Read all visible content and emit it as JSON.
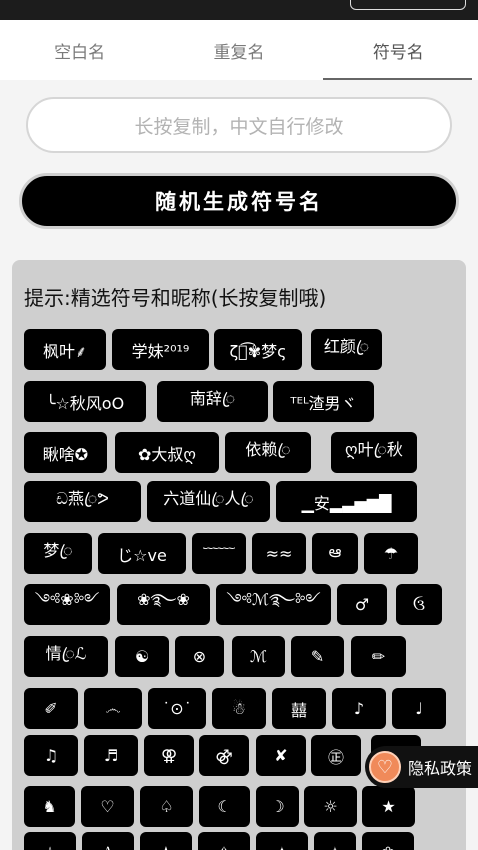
{
  "tabs": [
    "空白名",
    "重复名",
    "符号名"
  ],
  "active_tab_index": 2,
  "copy_field": {
    "placeholder": "长按复制，中文自行修改"
  },
  "generate_button": "随机生成符号名",
  "panel_title": "提示:精选符号和昵称(长按复制哦)",
  "chips": [
    [
      "枫叶⸙",
      "学妹²⁰¹⁹",
      "ζั͡✾梦ς",
      "红颜ꦿ"
    ],
    [
      "╰☆秋风oO",
      "南辞ꦿ",
      "ᵀᴱᴸ渣男ヾ"
    ],
    [
      "瞅啥✪",
      "✿大叔ღ",
      "依赖ꦿ",
      "ღ叶ꦿ秋"
    ],
    [
      "ඩ燕ꦿᕗ",
      "六道仙ꦿ人ꦿ",
      "▁安▂▃▅▆█"
    ],
    [
      "梦ꦿ",
      "じ☆ve",
      "﹋﹋",
      "≈≈",
      "ఆ",
      "☂"
    ],
    [
      "༺❀༻",
      "❀࿐❀",
      "༺ℳ࿐༻",
      "♂",
      "ઉ"
    ],
    [
      "情ꦿℒ",
      "☯",
      "⊗",
      "ℳ",
      "✎",
      "✏"
    ],
    [
      "✐",
      "෴",
      "˙⊙˙",
      "☃",
      "囍",
      "♪",
      "♩"
    ],
    [
      "♫",
      "♬",
      "⚢",
      "⚣",
      "✘",
      "㊣",
      "☏"
    ],
    [
      "♞",
      "♡",
      "♤",
      "☾",
      "☽",
      "☼",
      "★"
    ],
    [
      "☆",
      "✰",
      "✫",
      "✬",
      "✦",
      "✧",
      "❀"
    ]
  ],
  "icons": {
    "privacy": "heart-icon"
  },
  "privacy_button": "隐私政策"
}
